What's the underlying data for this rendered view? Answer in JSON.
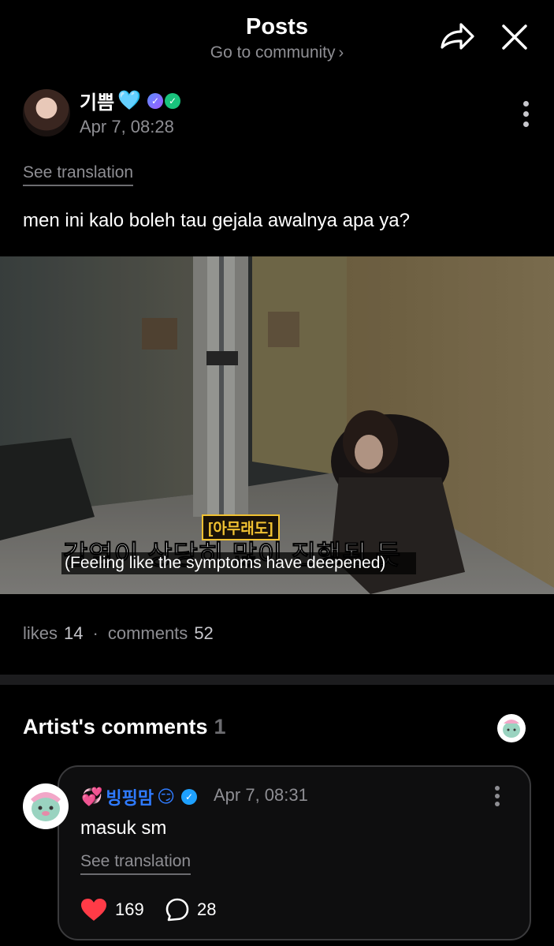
{
  "header": {
    "title": "Posts",
    "subtitle": "Go to community",
    "subtitle_chevron": "›",
    "share_icon": "share-arrow-icon",
    "close_icon": "close-icon"
  },
  "post": {
    "author": {
      "name": "기쁨",
      "heart": "🩵",
      "badge_1": "✓",
      "badge_2": "✓"
    },
    "time": "Apr 7, 08:28",
    "see_translation": "See translation",
    "text": "men ini kalo boleh tau gejala awalnya apa ya?",
    "media": {
      "caption_tag": "[아무래도]",
      "caption_ko": "감염이 상당히 많이 진행된 듯",
      "caption_en": "(Feeling like the symptoms have deepened)"
    },
    "stats": {
      "likes_label": "likes",
      "likes": "14",
      "separator": "·",
      "comments_label": "comments",
      "comments": "52"
    }
  },
  "artist_comments": {
    "title": "Artist's comments",
    "count": "1",
    "comment": {
      "emoji_prefix": "💞",
      "name": "빙핑맘",
      "emoji_suffix": "😏",
      "verified": "✓",
      "time": "Apr 7, 08:31",
      "text": "masuk sm",
      "see_translation": "See translation",
      "likes": "169",
      "replies": "28"
    }
  },
  "colors": {
    "background": "#000000",
    "muted": "#8e8e93",
    "artist_name": "#2f7bff",
    "like_heart": "#ff3b47"
  }
}
